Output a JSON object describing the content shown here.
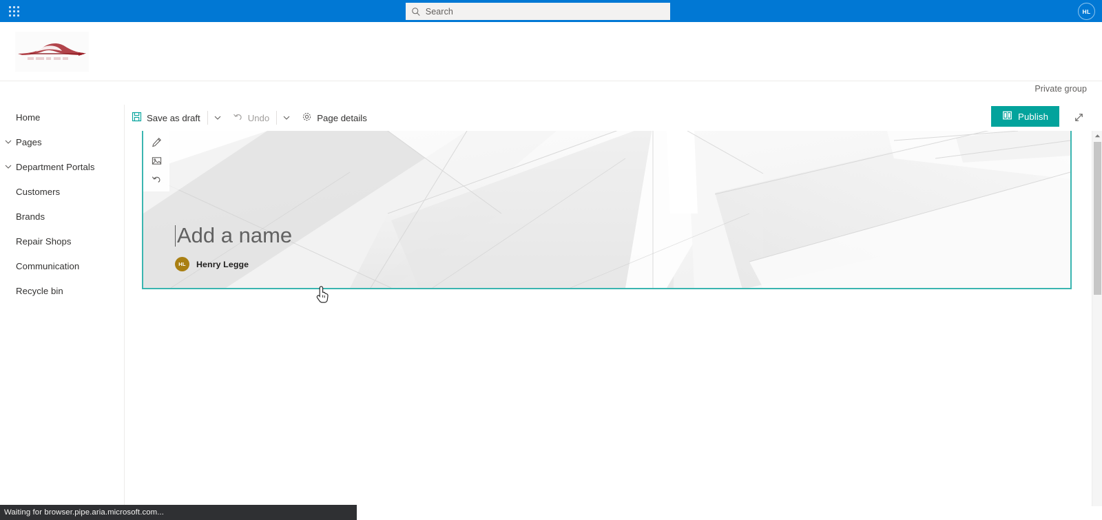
{
  "suite_bar": {
    "waffle_label": "App launcher",
    "search": {
      "placeholder": "Search",
      "value": ""
    },
    "avatar_initials": "HL",
    "bg_color": "#0178d4"
  },
  "site_header": {
    "logo_name": "car-logo",
    "privacy_label": "Private group"
  },
  "left_nav": {
    "items": [
      {
        "label": "Home",
        "chevron": false
      },
      {
        "label": "Pages",
        "chevron": true
      },
      {
        "label": "Department Portals",
        "chevron": true
      },
      {
        "label": "Customers",
        "chevron": false
      },
      {
        "label": "Brands",
        "chevron": false
      },
      {
        "label": "Repair Shops",
        "chevron": false
      },
      {
        "label": "Communication",
        "chevron": false
      },
      {
        "label": "Recycle bin",
        "chevron": false
      }
    ]
  },
  "command_bar": {
    "save_as_draft": "Save as draft",
    "save_caret": "⌄",
    "undo": "Undo",
    "undo_caret": "⌄",
    "page_details": "Page details",
    "publish": "Publish",
    "publish_color": "#03a39c",
    "expand_label": "Full screen"
  },
  "hero": {
    "tools": [
      {
        "name": "pencil-icon",
        "label": "Edit web part"
      },
      {
        "name": "change-image-icon",
        "label": "Change image"
      },
      {
        "name": "reset-icon",
        "label": "Reset"
      }
    ],
    "title_placeholder": "Add a name",
    "author_initials": "HL",
    "author_name": "Henry Legge",
    "author_avatar_color": "#a97f12",
    "selection_color": "#3ab5b0"
  },
  "scrollbar": {
    "up_arrow": "▴",
    "thumb_label": "Vertical scrollbar thumb"
  },
  "status_bar": {
    "text": "Waiting for browser.pipe.aria.microsoft.com..."
  }
}
